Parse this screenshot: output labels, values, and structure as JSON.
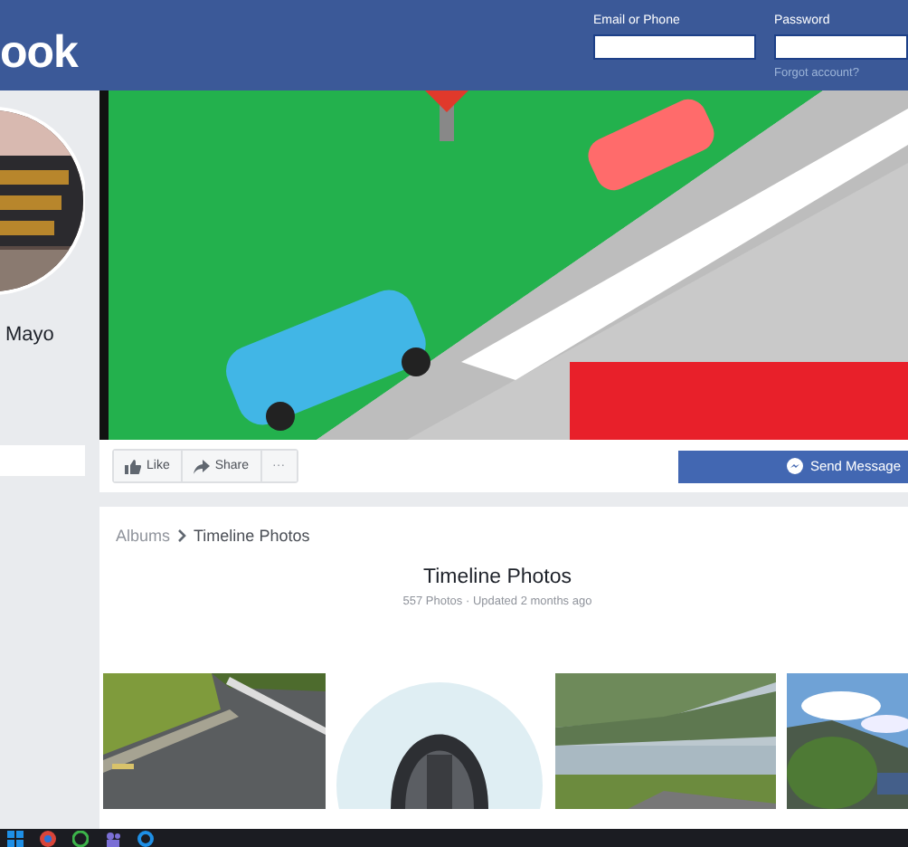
{
  "header": {
    "logo": "ook",
    "login": {
      "email_label": "Email or Phone",
      "password_label": "Password",
      "forgot_link": "Forgot account?"
    }
  },
  "sidebar": {
    "page_name": "Mayo"
  },
  "cover": {
    "kind": "picture"
  },
  "actions": [
    {
      "kind": "like",
      "label": "Like"
    },
    {
      "kind": "share",
      "label": "Share"
    },
    {
      "kind": "more",
      "label": "···"
    }
  ],
  "send_message": "Send Message",
  "breadcrumb": [
    "Albums",
    "Timeline Photos"
  ],
  "album": {
    "title": "Timeline Photos",
    "meta": "557 Photos · Updated 2 months ago"
  },
  "photos": [
    {
      "kind": "road"
    },
    {
      "kind": "car-seat"
    },
    {
      "kind": "lake"
    },
    {
      "kind": "hills"
    }
  ]
}
